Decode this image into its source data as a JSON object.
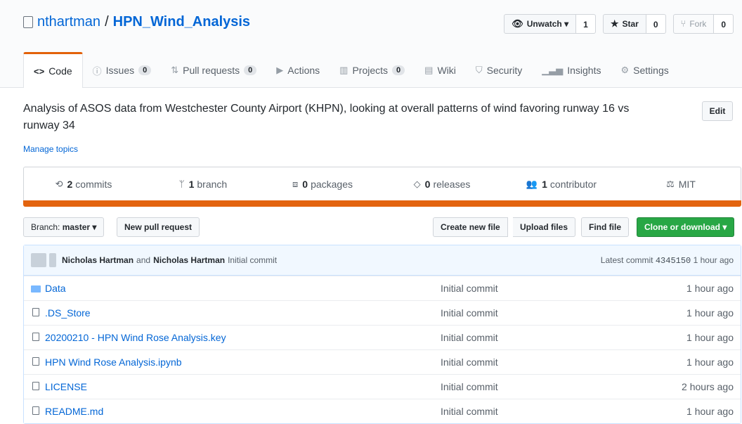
{
  "repo": {
    "owner": "nthartman",
    "separator": "/",
    "name": "HPN_Wind_Analysis"
  },
  "header_actions": {
    "watch_label": "Unwatch ▾",
    "watch_count": "1",
    "star_label": "Star",
    "star_count": "0",
    "fork_label": "Fork",
    "fork_count": "0"
  },
  "tabs": [
    {
      "label": "Code",
      "icon": "code-icon"
    },
    {
      "label": "Issues",
      "counter": "0",
      "icon": "issue-icon"
    },
    {
      "label": "Pull requests",
      "counter": "0",
      "icon": "pull-request-icon"
    },
    {
      "label": "Actions",
      "icon": "play-icon"
    },
    {
      "label": "Projects",
      "counter": "0",
      "icon": "project-icon"
    },
    {
      "label": "Wiki",
      "icon": "book-icon"
    },
    {
      "label": "Security",
      "icon": "shield-icon"
    },
    {
      "label": "Insights",
      "icon": "graph-icon"
    },
    {
      "label": "Settings",
      "icon": "gear-icon"
    }
  ],
  "description": "Analysis of ASOS data from Westchester County Airport (KHPN), looking at overall patterns of wind favoring runway 16 vs runway 34",
  "edit_label": "Edit",
  "manage_topics": "Manage topics",
  "summary": {
    "commits_num": "2",
    "commits_label": "commits",
    "branch_num": "1",
    "branch_label": "branch",
    "packages_num": "0",
    "packages_label": "packages",
    "releases_num": "0",
    "releases_label": "releases",
    "contributor_num": "1",
    "contributor_label": "contributor",
    "license": "MIT"
  },
  "language_color": "#e3640f",
  "toolbar": {
    "branch_prefix": "Branch:",
    "branch_name": "master ▾",
    "new_pr": "New pull request",
    "create_file": "Create new file",
    "upload_files": "Upload files",
    "find_file": "Find file",
    "clone": "Clone or download ▾"
  },
  "latest_commit": {
    "author1": "Nicholas Hartman",
    "and": "and",
    "author2": "Nicholas Hartman",
    "message": "Initial commit",
    "prefix": "Latest commit",
    "sha": "4345150",
    "age": "1 hour ago"
  },
  "files": [
    {
      "name": "Data",
      "type": "folder",
      "message": "Initial commit",
      "age": "1 hour ago"
    },
    {
      "name": ".DS_Store",
      "type": "file",
      "message": "Initial commit",
      "age": "1 hour ago"
    },
    {
      "name": "20200210 - HPN Wind Rose Analysis.key",
      "type": "file",
      "message": "Initial commit",
      "age": "1 hour ago"
    },
    {
      "name": "HPN Wind Rose Analysis.ipynb",
      "type": "file",
      "message": "Initial commit",
      "age": "1 hour ago"
    },
    {
      "name": "LICENSE",
      "type": "file",
      "message": "Initial commit",
      "age": "2 hours ago"
    },
    {
      "name": "README.md",
      "type": "file",
      "message": "Initial commit",
      "age": "1 hour ago"
    }
  ]
}
